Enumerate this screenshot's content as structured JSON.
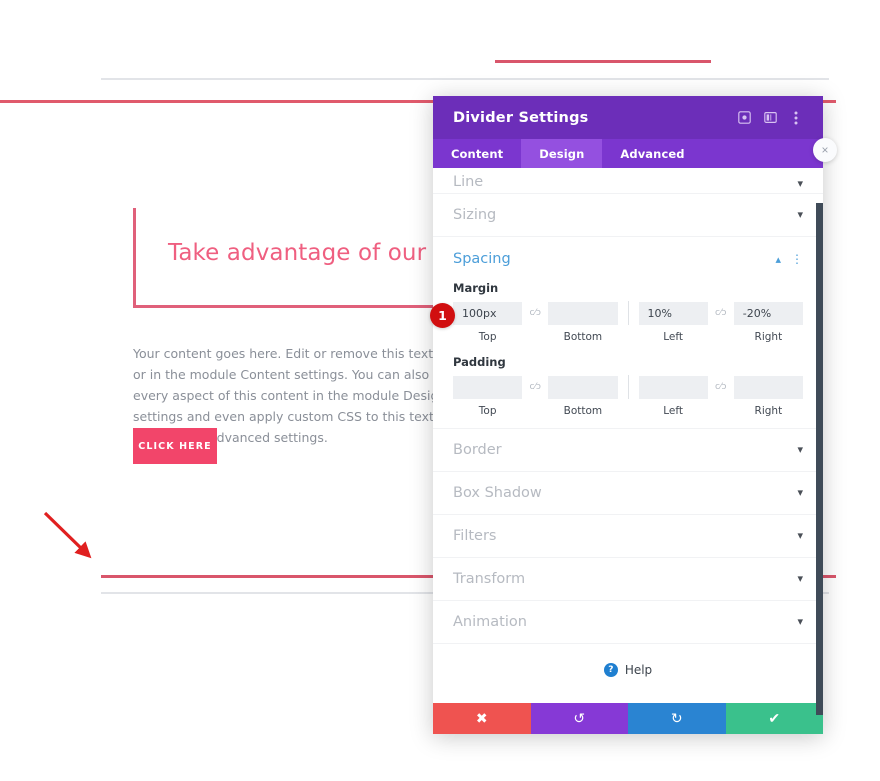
{
  "page": {
    "headline": "Take advantage of our deal!",
    "body_copy": "Your content goes here. Edit or remove this text inline or in the module Content settings. You can also style every aspect of this content in the module Design settings and even apply custom CSS to this text in the module Advanced settings.",
    "cta_label": "CLICK HERE",
    "colors": {
      "divider_red": "#d9566b",
      "rule_gray": "#e2e4e8",
      "headline_pink": "#ef5f80",
      "cta_pink": "#f2456a",
      "arrow_red": "#e02020"
    }
  },
  "modal": {
    "title": "Divider Settings",
    "header_icons": [
      {
        "name": "focus-icon",
        "glyph": "target"
      },
      {
        "name": "layout-columns-icon",
        "glyph": "columns"
      },
      {
        "name": "more-vertical-icon",
        "glyph": "dots"
      }
    ],
    "close_label": "×",
    "tabs": [
      {
        "id": "content",
        "label": "Content",
        "active": false
      },
      {
        "id": "design",
        "label": "Design",
        "active": true
      },
      {
        "id": "advanced",
        "label": "Advanced",
        "active": false
      }
    ],
    "sections_above": [
      {
        "id": "line",
        "label": "Line",
        "state": "collapsed"
      },
      {
        "id": "sizing",
        "label": "Sizing",
        "state": "collapsed"
      }
    ],
    "spacing": {
      "title": "Spacing",
      "state": "expanded",
      "margin": {
        "label": "Margin",
        "link_icon": "c⁄ɔ",
        "fields": [
          {
            "side": "Top",
            "value": "100px"
          },
          {
            "side": "Bottom",
            "value": ""
          },
          {
            "side": "Left",
            "value": "10%"
          },
          {
            "side": "Right",
            "value": "-20%"
          }
        ]
      },
      "padding": {
        "label": "Padding",
        "link_icon": "c⁄ɔ",
        "fields": [
          {
            "side": "Top",
            "value": ""
          },
          {
            "side": "Bottom",
            "value": ""
          },
          {
            "side": "Left",
            "value": ""
          },
          {
            "side": "Right",
            "value": ""
          }
        ]
      }
    },
    "sections_below": [
      {
        "id": "border",
        "label": "Border",
        "state": "collapsed"
      },
      {
        "id": "box-shadow",
        "label": "Box Shadow",
        "state": "collapsed"
      },
      {
        "id": "filters",
        "label": "Filters",
        "state": "collapsed"
      },
      {
        "id": "transform",
        "label": "Transform",
        "state": "collapsed"
      },
      {
        "id": "animation",
        "label": "Animation",
        "state": "collapsed"
      }
    ],
    "help": {
      "label": "Help",
      "badge": "?"
    },
    "footer_buttons": [
      {
        "id": "cancel",
        "name": "cancel-button",
        "glyph": "✖",
        "color": "#ef5350"
      },
      {
        "id": "undo",
        "name": "undo-button",
        "glyph": "↺",
        "color": "#8639d6"
      },
      {
        "id": "redo",
        "name": "redo-button",
        "glyph": "↻",
        "color": "#2a84d2"
      },
      {
        "id": "save",
        "name": "save-button",
        "glyph": "✔",
        "color": "#3ac18c"
      }
    ],
    "colors": {
      "header_purple": "#6c2eb9",
      "tabbar_purple": "#7b36cf",
      "tab_active_purple": "#9450e0",
      "section_open_blue": "#4c9ed9"
    }
  },
  "annotation": {
    "badge_number": "1"
  }
}
